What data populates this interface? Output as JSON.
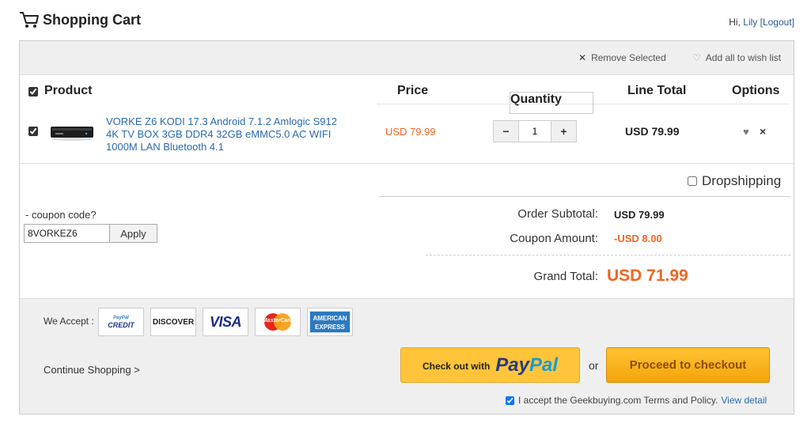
{
  "header": {
    "title": "Shopping Cart",
    "greeting": "Hi,",
    "user_name": "Lily",
    "logout_label": "[Logout]"
  },
  "toolbar": {
    "remove_selected": "Remove Selected",
    "add_wishlist": "Add all to wish list"
  },
  "table": {
    "headers": {
      "product": "Product",
      "price": "Price",
      "quantity": "Quantity",
      "line_total": "Line Total",
      "options": "Options"
    }
  },
  "item": {
    "name": "VORKE Z6 KODI 17.3 Android 7.1.2 Amlogic S912 4K TV BOX 3GB DDR4 32GB eMMC5.0 AC WIFI 1000M LAN Bluetooth 4.1",
    "price": "USD 79.99",
    "quantity": "1",
    "line_total": "USD 79.99",
    "checked": true
  },
  "dropshipping": {
    "label": "Dropshipping",
    "checked": false
  },
  "coupon": {
    "label": "- coupon code?",
    "value": "8VORKEZ6",
    "apply": "Apply"
  },
  "summary": {
    "subtotal_label": "Order Subtotal:",
    "subtotal_value": "USD 79.99",
    "coupon_label": "Coupon Amount:",
    "coupon_value": "-USD 8.00",
    "grand_label": "Grand Total:",
    "grand_value": "USD 71.99"
  },
  "footer": {
    "we_accept": "We Accept :",
    "cards": {
      "paypal_credit_small": "PayPal",
      "paypal_credit": "CREDIT",
      "discover": "DISCOVER",
      "visa": "VISA",
      "mastercard": "MasterCard",
      "amex_1": "AMERICAN",
      "amex_2": "EXPRESS"
    },
    "continue": "Continue Shopping >",
    "paypal_checkout": "Check out with",
    "paypal_pay": "Pay",
    "paypal_pal": "Pal",
    "or": "or",
    "proceed": "Proceed to checkout",
    "terms": "I accept the Geekbuying.com Terms and Policy.",
    "view_detail": "View detail"
  },
  "colors": {
    "accent_orange": "#f26522",
    "link_blue": "#2a6ab0",
    "paypal_yellow": "#ffc439",
    "checkout_orange": "#f3a50a"
  }
}
